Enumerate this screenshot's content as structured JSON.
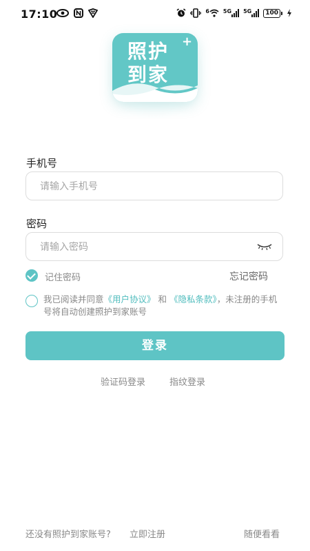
{
  "status_bar": {
    "time": "17:10",
    "left_icons": [
      "eye-icon",
      "nfc-icon",
      "shield-icon"
    ],
    "right_icons": [
      "alarm-icon",
      "vibrate-icon",
      "wifi-icon",
      "signal-5g-icon",
      "signal-5g-icon",
      "battery-icon"
    ],
    "network_1": "5G",
    "network_2": "5G",
    "wifi_tag": "6",
    "battery": "100"
  },
  "logo": {
    "line1": "照护",
    "line2": "到家",
    "plus": "+"
  },
  "form": {
    "phone_label": "手机号",
    "phone_placeholder": "请输入手机号",
    "phone_value": "",
    "password_label": "密码",
    "password_placeholder": "请输入密码",
    "password_value": "",
    "remember_label": "记住密码",
    "remember_checked": true,
    "forgot_label": "忘记密码"
  },
  "agreement": {
    "checked": false,
    "prefix": "我已阅读并同意",
    "user_agreement": "《用户协议》",
    "and": "和",
    "privacy_terms": "《隐私条款》",
    "suffix": "，未注册的手机号将自动创建照护到家账号"
  },
  "login_button": "登录",
  "alt_login": {
    "sms": "验证码登录",
    "fingerprint": "指纹登录"
  },
  "footer": {
    "no_account": "还没有照护到家账号?",
    "register": "立即注册",
    "browse": "随便看看"
  },
  "colors": {
    "accent": "#5ec4c5",
    "link": "#4fbcbd",
    "muted_text": "#888888"
  }
}
